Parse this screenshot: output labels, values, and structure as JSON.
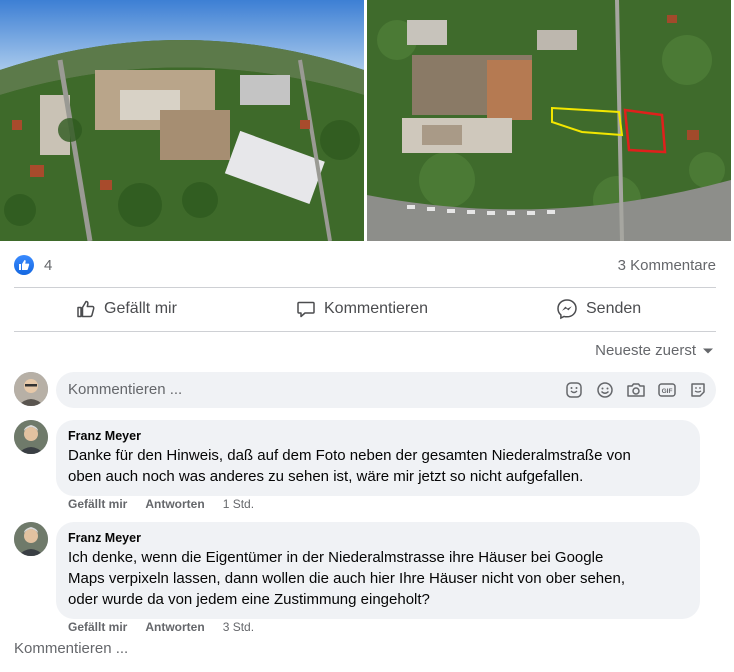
{
  "post": {
    "reaction_count": "4",
    "comment_count": "3 Kommentare"
  },
  "actions": {
    "like_label": "Gefällt mir",
    "comment_label": "Kommentieren",
    "send_label": "Senden"
  },
  "sort": {
    "label": "Neueste zuerst"
  },
  "composer": {
    "placeholder": "Kommentieren ...",
    "icons": [
      "sticker-icon",
      "emoji-icon",
      "camera-icon",
      "gif-icon",
      "avatar-sticker-icon"
    ]
  },
  "comments": [
    {
      "author": "Franz Meyer",
      "text_lines": [
        "Danke für den Hinweis, daß auf dem Foto neben der gesamten Niederalmstraße von",
        "oben auch noch was anderes zu sehen ist, wäre mir jetzt so nicht aufgefallen."
      ],
      "like": "Gefällt mir",
      "reply": "Antworten",
      "time": "1 Std."
    },
    {
      "author": "Franz Meyer",
      "text_lines": [
        "Ich denke, wenn die Eigentümer in der Niederalmstrasse ihre Häuser bei Google",
        "Maps verpixeln lassen, dann wollen die auch hier Ihre Häuser nicht von ober sehen,",
        "oder wurde da von jedem eine Zustimmung eingeholt?"
      ],
      "like": "Gefällt mir",
      "reply": "Antworten",
      "time": "3 Std."
    }
  ],
  "footer": {
    "label": "Kommentieren ..."
  },
  "colors": {
    "meta_gray": "#65676b",
    "bubble_bg": "#f0f2f5",
    "like_blue": "#1877f2",
    "highlight_yellow": "#f2e600",
    "highlight_red": "#e0201c"
  }
}
